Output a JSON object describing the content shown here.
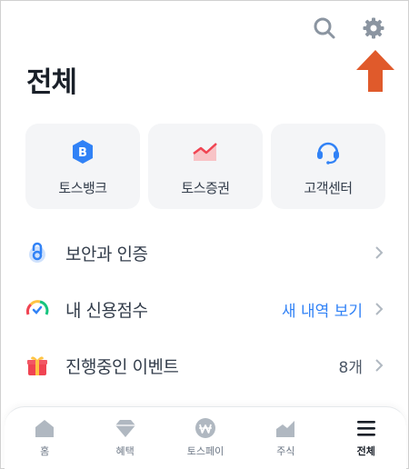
{
  "header": {
    "title": "전체",
    "search_icon": "search-icon",
    "settings_icon": "gear-icon",
    "annotation_color": "#e05a2b"
  },
  "shortcuts": [
    {
      "label": "토스뱅크",
      "icon": "bank-b-icon",
      "color": "#3182f6"
    },
    {
      "label": "토스증권",
      "icon": "stock-chart-icon",
      "color": "#f36c74"
    },
    {
      "label": "고객센터",
      "icon": "headset-icon",
      "color": "#3182f6"
    }
  ],
  "list": [
    {
      "label": "보안과 인증",
      "icon": "security-lock-icon",
      "value": ""
    },
    {
      "label": "내 신용점수",
      "icon": "credit-gauge-icon",
      "value": "새 내역 보기"
    },
    {
      "label": "진행중인 이벤트",
      "icon": "gift-icon",
      "value": "8개"
    }
  ],
  "tabs": [
    {
      "label": "홈",
      "icon": "home-icon",
      "active": false
    },
    {
      "label": "혜택",
      "icon": "diamond-icon",
      "active": false
    },
    {
      "label": "토스페이",
      "icon": "won-coin-icon",
      "active": false
    },
    {
      "label": "주식",
      "icon": "stock-icon",
      "active": false
    },
    {
      "label": "전체",
      "icon": "menu-icon",
      "active": true
    }
  ],
  "colors": {
    "accent": "#3182f6",
    "card_bg": "#f4f5f7",
    "icon_gray": "#8b95a1"
  }
}
